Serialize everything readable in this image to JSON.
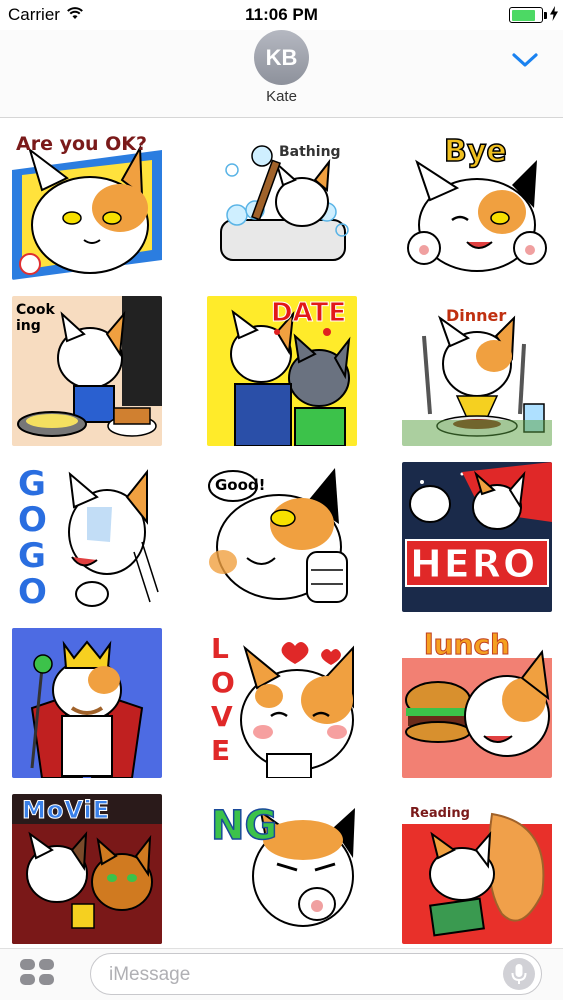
{
  "status_bar": {
    "carrier": "Carrier",
    "time": "11:06 PM",
    "battery_level": 0.85,
    "icons": [
      "wifi-icon",
      "battery-icon",
      "charging-bolt-icon"
    ]
  },
  "header": {
    "avatar_initials": "KB",
    "contact_name": "Kate",
    "expand_icon": "chevron-down-icon",
    "accent_color": "#1a82f0"
  },
  "stickers": [
    {
      "text": "Are you OK?"
    },
    {
      "text": "Bathing"
    },
    {
      "text": "Bye"
    },
    {
      "text": "Cook ing"
    },
    {
      "text": "DATE"
    },
    {
      "text": "Dinner"
    },
    {
      "text": "GOGO"
    },
    {
      "text": "Good!"
    },
    {
      "text": "HERO"
    },
    {
      "text": ""
    },
    {
      "text": "LOVE"
    },
    {
      "text": "lunch"
    },
    {
      "text": "MoViE"
    },
    {
      "text": "NG"
    },
    {
      "text": "Reading"
    }
  ],
  "bottom_bar": {
    "apps_icon": "app-drawer-icon",
    "input_placeholder": "iMessage",
    "mic_icon": "microphone-icon"
  }
}
